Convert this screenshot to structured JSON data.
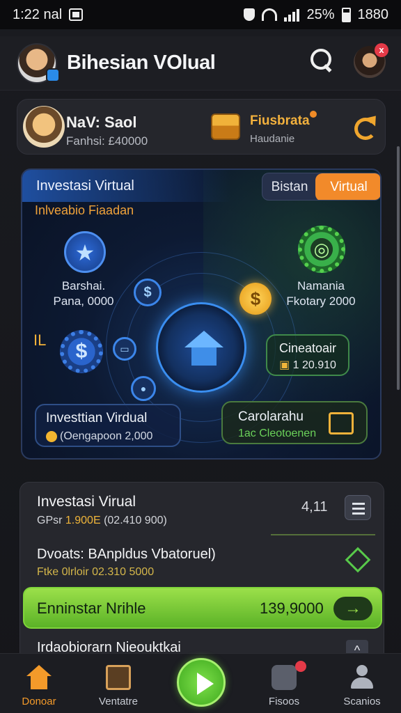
{
  "status": {
    "time": "1:22 nal",
    "battery": "25%",
    "clock_right": "1880"
  },
  "header": {
    "title": "Bihesian VOlual",
    "notification_count": "x"
  },
  "user": {
    "name": "NaV: Saol",
    "subtitle": "Fanhsi: £40000",
    "feature_label": "Fiusbrata",
    "feature_sub": "Haudanie"
  },
  "hero": {
    "title": "Investasi Virtual",
    "toggle": {
      "option_a": "Bistan",
      "option_b": "Virtual",
      "selected": "Virtual"
    },
    "subtitle": "Inlveabio Fiaadan",
    "left_label_1": "Barshai.",
    "left_label_2": "Pana, 0000",
    "right_label_1": "Namania",
    "right_label_2": "Fkotary 2000",
    "coin_symbol": "$",
    "tiny_label": "IL",
    "green_box": {
      "title": "Cineatoair",
      "value": "1 20.910"
    },
    "invest_box": {
      "title": "Investtian Virdual",
      "sub": "(Oengapoon 2,000"
    },
    "gc_box": {
      "title": "Carolarahu",
      "sub": "1ac Cleotoenen"
    }
  },
  "list": {
    "row1": {
      "title": "Investasi Virual",
      "sub_prefix": "GPsr",
      "sub_highlight": "1.900E",
      "sub_rest": "(02.410 900)",
      "value": "4,11"
    },
    "row2": {
      "title": "Dvoats: BAnpldus Vbatoruel)",
      "sub": "Ftke 0lrloir 02.310 5000"
    },
    "cta": {
      "label": "Enninstar Nrihle",
      "value": "139,9000",
      "arrow": "→"
    },
    "row3": {
      "title": "Irdaobiorarn Nieouktkai",
      "icon": "^"
    }
  },
  "nav": {
    "items": [
      {
        "label": "Donoar",
        "color": "#f39a2a"
      },
      {
        "label": "Ventatre",
        "color": "#c8ccd4"
      },
      {
        "label": "Fisoos",
        "color": "#c8ccd4"
      },
      {
        "label": "Scanios",
        "color": "#c8ccd4"
      }
    ]
  }
}
